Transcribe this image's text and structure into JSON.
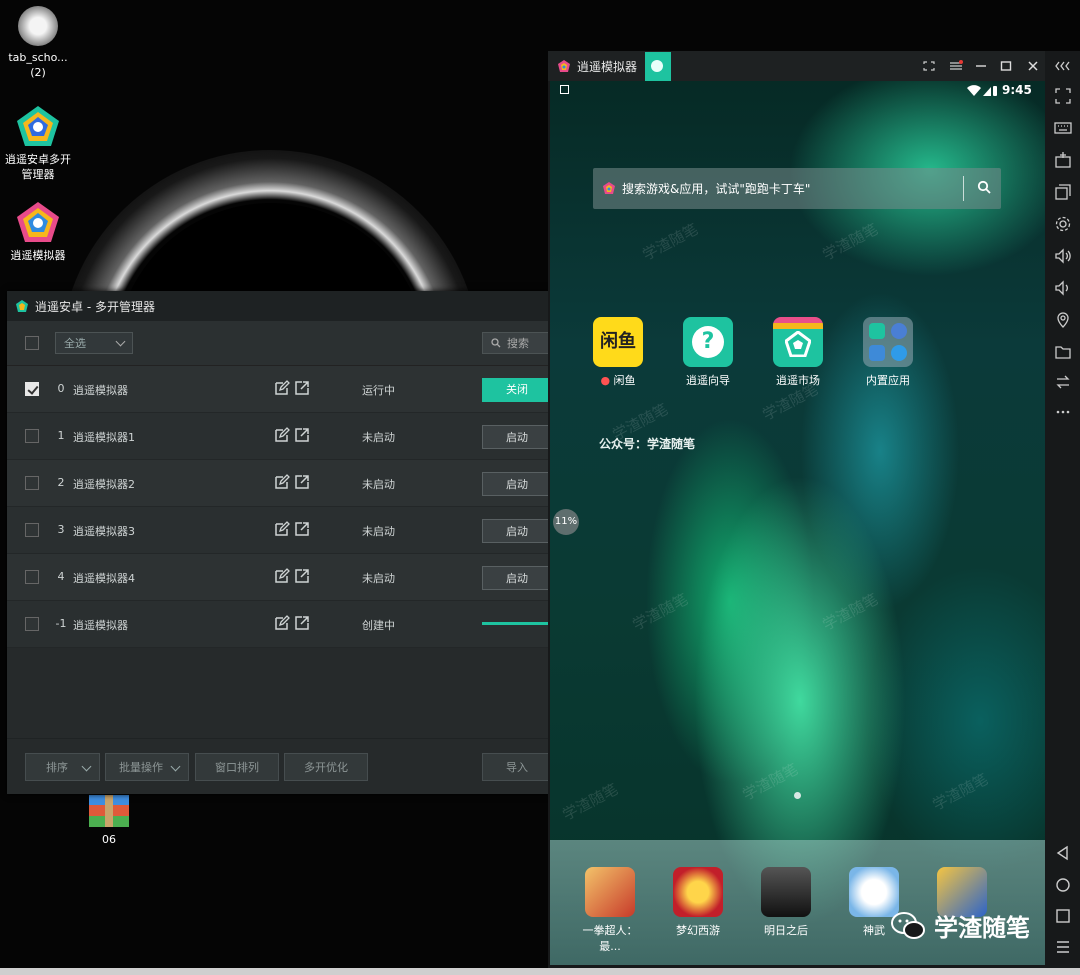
{
  "desktop": {
    "icons": [
      {
        "label": "tab_scho...",
        "sub": "(2)"
      },
      {
        "label": "逍遥安卓多开",
        "sub": "管理器"
      },
      {
        "label": "逍遥模拟器",
        "sub": ""
      },
      {
        "label": "06",
        "sub": ""
      }
    ]
  },
  "manager": {
    "title": "逍遥安卓 - 多开管理器",
    "select_all": "全选",
    "search_placeholder": "搜索",
    "rows": [
      {
        "index": "0",
        "name": "逍遥模拟器",
        "status": "运行中",
        "action": "关闭",
        "checked": true
      },
      {
        "index": "1",
        "name": "逍遥模拟器1",
        "status": "未启动",
        "action": "启动",
        "checked": false
      },
      {
        "index": "2",
        "name": "逍遥模拟器2",
        "status": "未启动",
        "action": "启动",
        "checked": false
      },
      {
        "index": "3",
        "name": "逍遥模拟器3",
        "status": "未启动",
        "action": "启动",
        "checked": false
      },
      {
        "index": "4",
        "name": "逍遥模拟器4",
        "status": "未启动",
        "action": "启动",
        "checked": false
      },
      {
        "index": "-1",
        "name": "逍遥模拟器",
        "status": "创建中",
        "action": "",
        "checked": false
      }
    ],
    "bottom": {
      "sort": "排序",
      "batch": "批量操作",
      "arrange": "窗口排列",
      "optimize": "多开优化",
      "import": "导入"
    }
  },
  "emulator": {
    "title": "逍遥模拟器",
    "time": "9:45",
    "search_placeholder": "搜索游戏&应用，试试\"跑跑卡丁车\"",
    "apps": [
      {
        "label": "闲鱼",
        "icon": "xianyu-icon",
        "icon_text": "闲鱼"
      },
      {
        "label": "逍遥向导",
        "icon": "help-icon",
        "icon_text": "?"
      },
      {
        "label": "逍遥市场",
        "icon": "market-icon",
        "icon_text": ""
      },
      {
        "label": "内置应用",
        "icon": "folder-icon",
        "icon_text": ""
      }
    ],
    "gongzhonghao": "公众号：学渣随笔",
    "progress_badge": "11%",
    "dock": [
      {
        "label": "一拳超人：最..."
      },
      {
        "label": "梦幻西游"
      },
      {
        "label": "明日之后"
      },
      {
        "label": "神武"
      },
      {
        "label": ""
      }
    ],
    "watermark": "学渣随笔"
  },
  "colors": {
    "accent": "#1ec3a0",
    "manager_bg": "#262a2b",
    "emulator_frame": "#17191a"
  }
}
